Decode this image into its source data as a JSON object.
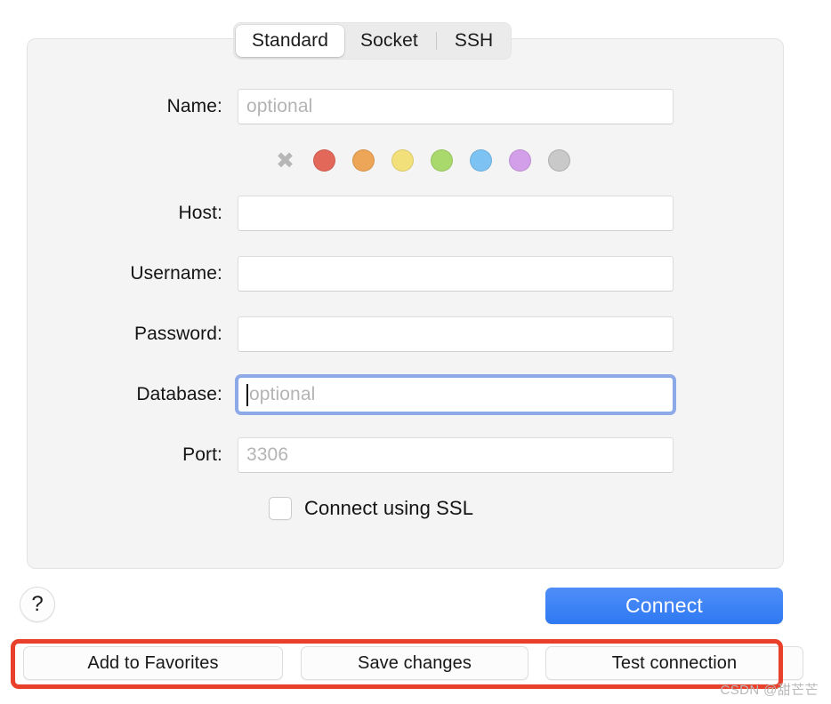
{
  "tabs": [
    {
      "label": "Standard",
      "selected": true
    },
    {
      "label": "Socket",
      "selected": false
    },
    {
      "label": "SSH",
      "selected": false
    }
  ],
  "form": {
    "name": {
      "label": "Name:",
      "value": "",
      "placeholder": "optional"
    },
    "host": {
      "label": "Host:",
      "value": "",
      "placeholder": ""
    },
    "username": {
      "label": "Username:",
      "value": "",
      "placeholder": ""
    },
    "password": {
      "label": "Password:",
      "value": "",
      "placeholder": ""
    },
    "database": {
      "label": "Database:",
      "value": "",
      "placeholder": "optional",
      "focused": true
    },
    "port": {
      "label": "Port:",
      "value": "",
      "placeholder": "3306"
    }
  },
  "color_swatches": [
    {
      "name": "none",
      "icon": "x-icon",
      "color": "#b6b6b6"
    },
    {
      "name": "red",
      "color": "#e2685a"
    },
    {
      "name": "orange",
      "color": "#eda557"
    },
    {
      "name": "yellow",
      "color": "#f2e07a"
    },
    {
      "name": "green",
      "color": "#a9d96c"
    },
    {
      "name": "blue",
      "color": "#7cc2f2"
    },
    {
      "name": "purple",
      "color": "#d39fe8"
    },
    {
      "name": "gray",
      "color": "#c9c9c9"
    }
  ],
  "ssl": {
    "label": "Connect using SSL",
    "checked": false
  },
  "help": {
    "glyph": "?",
    "icon": "question-mark-icon"
  },
  "connect": {
    "label": "Connect",
    "color": "#3b82f6"
  },
  "bottom_buttons": [
    {
      "label": "Add to Favorites"
    },
    {
      "label": "Save changes"
    },
    {
      "label": "Test connection"
    }
  ],
  "annotation": {
    "color": "#e8402a"
  },
  "watermark": {
    "text": "CSDN @甜芒芒"
  }
}
